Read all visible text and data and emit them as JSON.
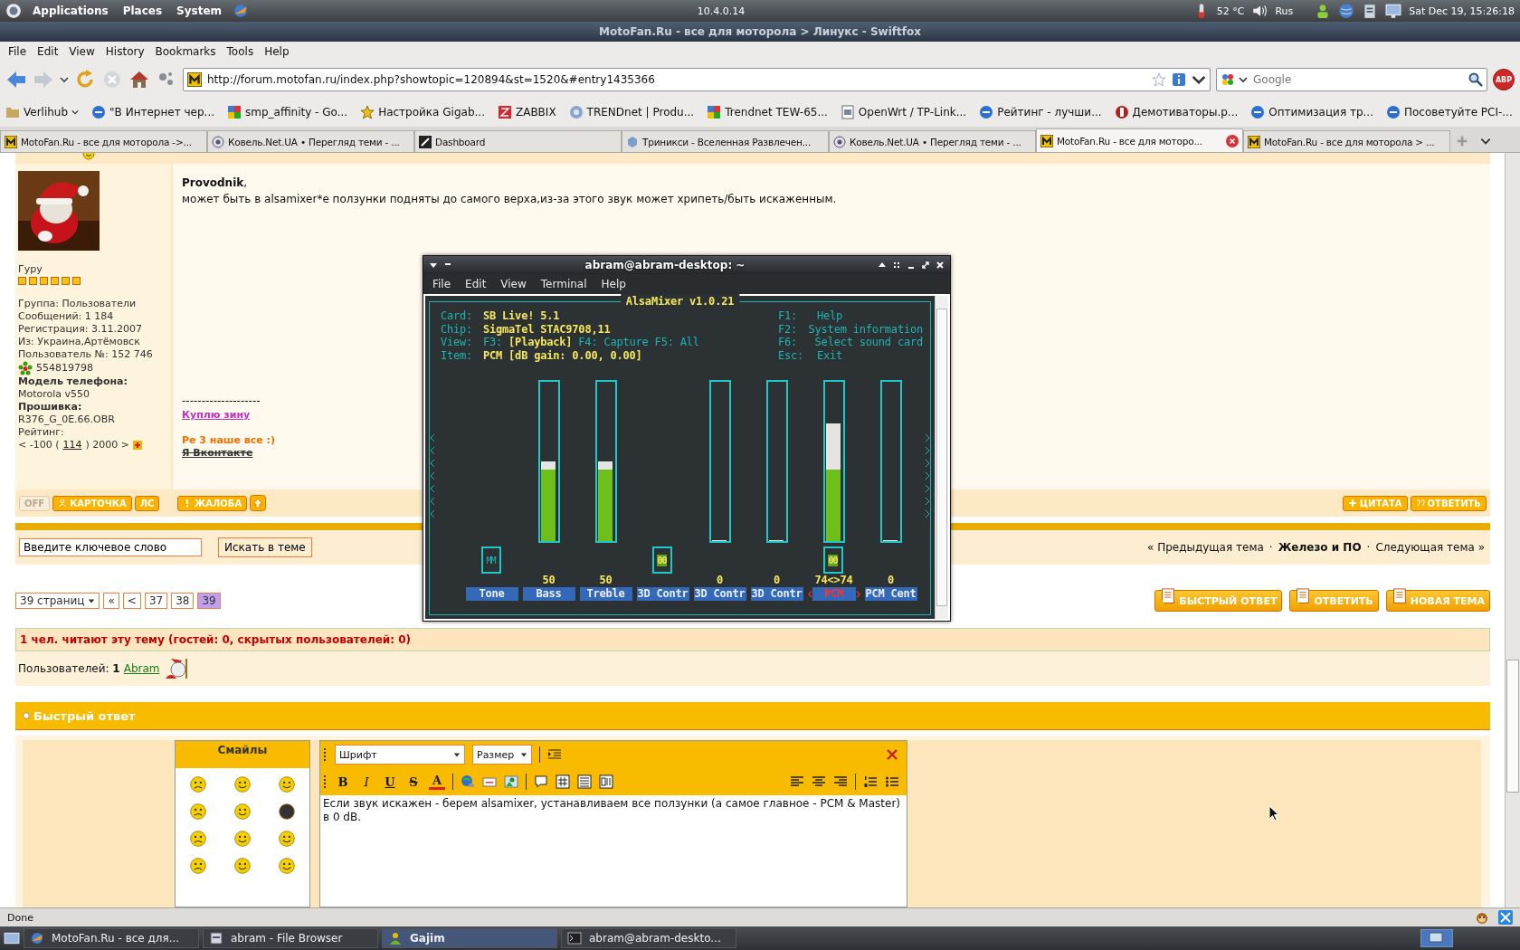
{
  "panel": {
    "menus": [
      "Applications",
      "Places",
      "System"
    ],
    "ip": "10.4.0.14",
    "temperature": "52 °C",
    "keyboard": "Rus",
    "clock": "Sat Dec 19, 15:26:18"
  },
  "browser": {
    "title": "MotoFan.Ru - все для моторола > Линукс - Swiftfox",
    "menu": [
      "File",
      "Edit",
      "View",
      "History",
      "Bookmarks",
      "Tools",
      "Help"
    ],
    "url": "http://forum.motofan.ru/index.php?showtopic=120894&st=1520&#entry1435366",
    "search": {
      "placeholder": "Google"
    },
    "addon_badge": "ABP",
    "bookmarks": [
      {
        "label": "Verlihub",
        "kind": "folder"
      },
      {
        "label": "\"В Интернет чер...",
        "kind": "nag"
      },
      {
        "label": "smp_affinity - Go...",
        "kind": "google"
      },
      {
        "label": "Настройка Gigab...",
        "kind": "star"
      },
      {
        "label": "ZABBIX",
        "kind": "zabbix"
      },
      {
        "label": "TRENDnet | Produ...",
        "kind": "globe"
      },
      {
        "label": "Trendnet TEW-65...",
        "kind": "google"
      },
      {
        "label": "OpenWrt / TP-Link...",
        "kind": "page"
      },
      {
        "label": "Рейтинг - лучши...",
        "kind": "nag"
      },
      {
        "label": "Демотиваторы.р...",
        "kind": "stop"
      },
      {
        "label": "Оптимизация тр...",
        "kind": "nag"
      },
      {
        "label": "Посоветуйте PCI-...",
        "kind": "nag"
      }
    ],
    "tabs": [
      {
        "label": "MotoFan.Ru - все для моторола ->...",
        "kind": "moto",
        "selected": false
      },
      {
        "label": "Ковель.Net.UA • Перегляд теми - ...",
        "kind": "page",
        "selected": false
      },
      {
        "label": "Dashboard",
        "kind": "dash",
        "selected": false
      },
      {
        "label": "Триникси - Вселенная Развлечен...",
        "kind": "cube",
        "selected": false
      },
      {
        "label": "Ковель.Net.UA • Перегляд теми - ...",
        "kind": "page",
        "selected": false
      },
      {
        "label": "MotoFan.Ru - все для моторо...",
        "kind": "moto",
        "selected": true
      },
      {
        "label": "MotoFan.Ru - все для моторола > ...",
        "kind": "moto",
        "selected": false
      }
    ],
    "status": "Done"
  },
  "post": {
    "rank": "Гуру",
    "stars": 6,
    "profile": [
      "Группа: Пользователи",
      "Сообщений: 1 184",
      "Регистрация: 3.11.2007",
      "Из: Украина,Артёмовск",
      "Пользователь №: 152 746"
    ],
    "icq": "554819798",
    "details": [
      "**Модель телефона:** Motorola v550",
      "**Прошивка:**",
      "R376_G_0E.66.OBR",
      "Рейтинг:"
    ],
    "rating": {
      "before": "< -100 (",
      "value": "114",
      "after": ") 2000 >"
    },
    "greeting": "**Provodnik**,",
    "message": "может быть в alsamixer*е ползунки подняты до самого верха,из-за этого звук может хрипеть/быть искаженным.",
    "signature": {
      "rule": "--------------------",
      "link": "Куплю зину",
      "motto": "Ре 3 наше все :)",
      "struck": "Я Вконтакте"
    },
    "left_buttons": [
      {
        "label": "OFF",
        "kind": "off"
      },
      {
        "label": "КАРТОЧКА",
        "kind": "person"
      },
      {
        "label": "ЛС",
        "kind": "text"
      }
    ],
    "middle_buttons": [
      {
        "label": "ЖАЛОБА",
        "kind": "alert"
      }
    ],
    "right_buttons": [
      {
        "label": "ЦИТАТА",
        "kind": "plus"
      },
      {
        "label": "ОТВЕТИТЬ",
        "kind": "quote"
      }
    ]
  },
  "topic_search": {
    "value": "Введите ключевое слово",
    "button": "Искать в теме"
  },
  "topic_nav": [
    {
      "text": "« Предыдущая тема",
      "kind": "link"
    },
    {
      "text": "·",
      "kind": "sep"
    },
    {
      "text": "Железо и ПО",
      "kind": "bold"
    },
    {
      "text": "·",
      "kind": "sep"
    },
    {
      "text": "Следующая тема »",
      "kind": "link"
    }
  ],
  "pagination": {
    "dropdown": "39 страниц",
    "pages": [
      {
        "label": "«",
        "selected": false
      },
      {
        "label": "<",
        "selected": false
      },
      {
        "label": "37",
        "selected": false
      },
      {
        "label": "38",
        "selected": false
      },
      {
        "label": "39",
        "selected": true
      }
    ]
  },
  "topic_buttons": [
    {
      "label": "БЫСТРЫЙ ОТВЕТ",
      "kind": "down"
    },
    {
      "label": "ОТВЕТИТЬ",
      "kind": "plus"
    },
    {
      "label": "НОВАЯ ТЕМА",
      "kind": "doc"
    }
  ],
  "readers": {
    "summary": "1 чел. читают эту тему (гостей: 0, скрытых пользователей: 0)",
    "users_label": "Пользователей: **1**",
    "user": "Abram"
  },
  "quick_reply": {
    "title": "Быстрый ответ",
    "smileys_title": "Смайлы",
    "font": "Шрифт",
    "size": "Размер",
    "format_buttons": [
      {
        "label": "B",
        "kind": "bold"
      },
      {
        "label": "I",
        "kind": "italic"
      },
      {
        "label": "U",
        "kind": "underline"
      },
      {
        "label": "S",
        "kind": "strike"
      },
      {
        "label": "A",
        "kind": "color"
      }
    ],
    "text": "Если звук искажен - берем alsamixer, устанавливаем все ползунки (а самое главное - PCM & Master) в 0 dB."
  },
  "terminal": {
    "title": "abram@abram-desktop: ~",
    "menu": [
      "File",
      "Edit",
      "View",
      "Terminal",
      "Help"
    ],
    "app": "AlsaMixer v1.0.21",
    "info": [
      {
        "label": "Card:",
        "parts": [
          {
            "text": "SB Live! 5.1",
            "highlight": true
          }
        ]
      },
      {
        "label": "Chip:",
        "parts": [
          {
            "text": "SigmaTel STAC9708,11",
            "highlight": true
          }
        ]
      },
      {
        "label": "View:",
        "parts": [
          {
            "text": "F3:",
            "highlight": false
          },
          {
            "text": "[Playback]",
            "highlight": true
          },
          {
            "text": "F4: Capture",
            "highlight": false
          },
          {
            "text": "F5: All",
            "highlight": false
          }
        ]
      },
      {
        "label": "Item:",
        "parts": [
          {
            "text": "PCM [dB gain: 0.00, 0.00]",
            "highlight": true
          }
        ]
      }
    ],
    "keys": [
      {
        "key": "F1:",
        "action": "Help"
      },
      {
        "key": "F2:",
        "action": "System information"
      },
      {
        "key": "F6:",
        "action": "Select sound card"
      },
      {
        "key": "Esc:",
        "action": "Exit"
      }
    ],
    "channels": [
      {
        "name": "Tone",
        "kind": "switch",
        "switch": "MM",
        "on": false,
        "selected": false
      },
      {
        "name": "Bass",
        "kind": "slider",
        "reading": "50",
        "level": 0.5,
        "selected": false
      },
      {
        "name": "Treble",
        "kind": "slider",
        "reading": "50",
        "level": 0.5,
        "selected": false
      },
      {
        "name": "3D Contr",
        "kind": "switch",
        "switch": "00",
        "on": true,
        "selected": false
      },
      {
        "name": "3D Contr",
        "kind": "slider",
        "reading": "0",
        "level": 0,
        "selected": false
      },
      {
        "name": "3D Contr",
        "kind": "slider",
        "reading": "0",
        "level": 0,
        "selected": false
      },
      {
        "name": "PCM",
        "kind": "both",
        "reading": "74<>74",
        "level": 0.74,
        "switch": "00",
        "on": true,
        "selected": true
      },
      {
        "name": "PCM Cent",
        "kind": "slider",
        "reading": "0",
        "level": 0,
        "selected": false
      }
    ]
  },
  "taskbar": [
    {
      "label": "MotoFan.Ru - все для...",
      "kind": "browser",
      "selected": false
    },
    {
      "label": "abram - File Browser",
      "kind": "folder",
      "selected": false
    },
    {
      "label": "Gajim",
      "kind": "chat",
      "selected": true
    },
    {
      "label": "abram@abram-deskto...",
      "kind": "terminal",
      "selected": false
    }
  ]
}
